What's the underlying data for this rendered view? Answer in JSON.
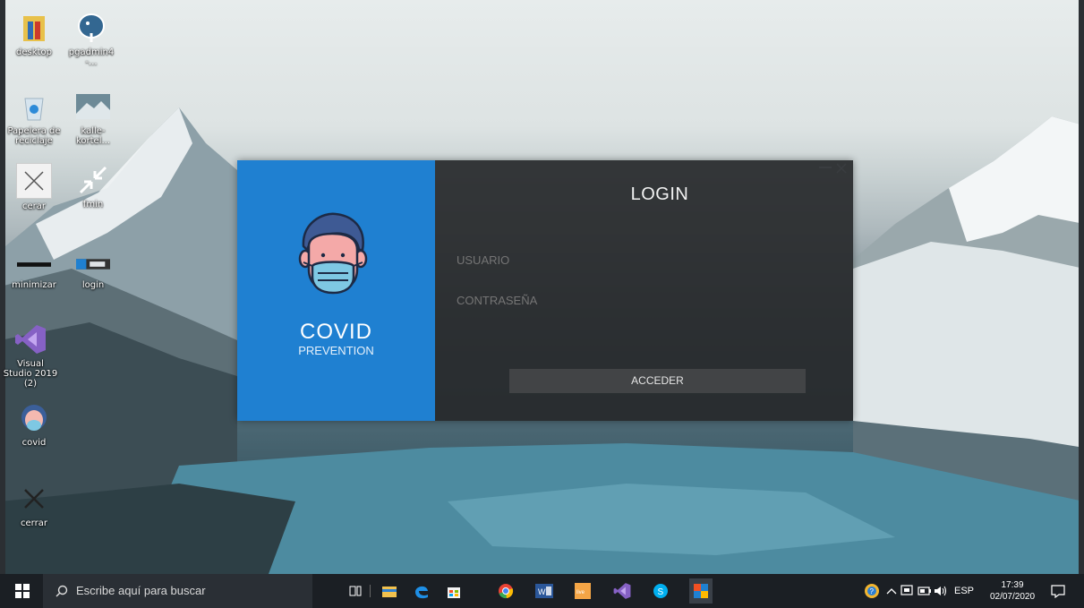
{
  "desktop_icons": [
    {
      "label": "desktop",
      "icon": "folder-icon"
    },
    {
      "label": "pgadmin4 -...",
      "icon": "postgres-elephant-icon"
    },
    {
      "label": "Papelera de reciclaje",
      "icon": "recycle-bin-icon"
    },
    {
      "label": "kalle-kortel...",
      "icon": "image-file-icon"
    },
    {
      "label": "cerar",
      "icon": "close-x-icon"
    },
    {
      "label": "fmin",
      "icon": "minimize-arrows-icon"
    },
    {
      "label": "minimizar",
      "icon": "dash-icon"
    },
    {
      "label": "login",
      "icon": "login-app-icon"
    },
    {
      "label": "Visual Studio 2019 (2)",
      "icon": "visual-studio-icon"
    },
    {
      "label": "covid",
      "icon": "covid-face-icon"
    },
    {
      "label": "cerrar",
      "icon": "close-x-icon"
    }
  ],
  "login_window": {
    "brand_title": "COVID",
    "brand_subtitle": "PREVENTION",
    "title": "LOGIN",
    "username_placeholder": "USUARIO",
    "password_placeholder": "CONTRASEÑA",
    "submit_label": "ACCEDER",
    "accent_color": "#1f80d1",
    "panel_color": "#26282a"
  },
  "taskbar": {
    "search_placeholder": "Escribe aquí para buscar",
    "language": "ESP",
    "time": "17:39",
    "date": "02/07/2020",
    "pinned_apps": [
      "task-view-icon",
      "file-explorer-icon",
      "edge-icon",
      "store-icon",
      "chrome-icon",
      "word-icon",
      "live-icon",
      "visual-studio-icon",
      "skype-icon",
      "app-window-icon"
    ]
  }
}
